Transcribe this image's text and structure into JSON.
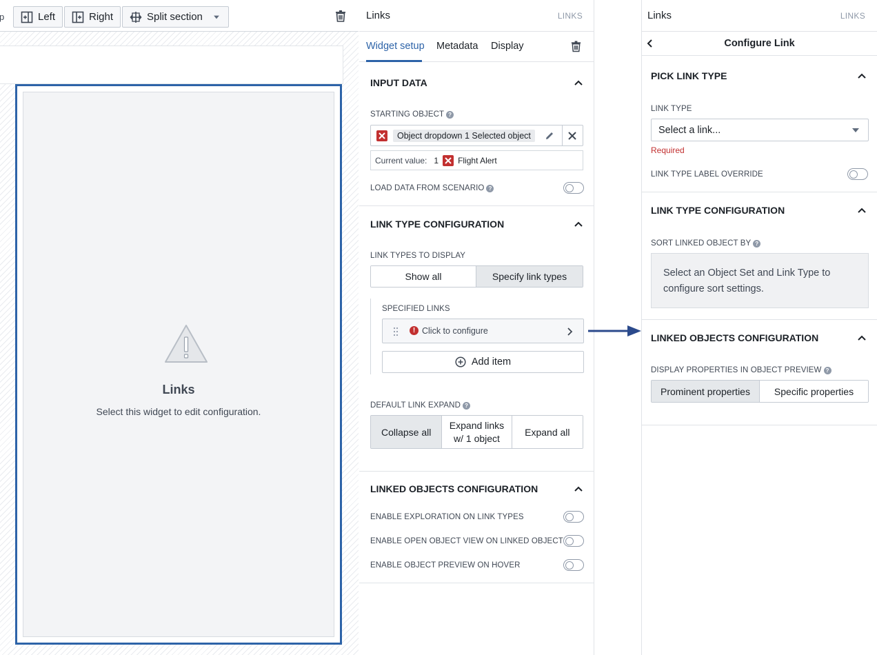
{
  "toolbar": {
    "cut_label": "p",
    "left_label": "Left",
    "right_label": "Right",
    "split_label": "Split section"
  },
  "widget": {
    "title": "Links",
    "subtitle": "Select this widget to edit configuration."
  },
  "panel1": {
    "title": "Links",
    "tag": "LINKS",
    "tabs": [
      "Widget setup",
      "Metadata",
      "Display"
    ],
    "active_tab": "Widget setup",
    "input_data": {
      "title": "INPUT DATA",
      "starting_object_label": "STARTING OBJECT",
      "starting_object_value": "Object dropdown 1 Selected object",
      "current_value_label": "Current value:",
      "current_value_count": "1",
      "current_value_name": "Flight Alert",
      "load_scenario_label": "LOAD DATA FROM SCENARIO"
    },
    "link_type_config": {
      "title": "LINK TYPE CONFIGURATION",
      "display_label": "LINK TYPES TO DISPLAY",
      "options": [
        "Show all",
        "Specify link types"
      ],
      "selected": "Specify link types",
      "specified_links_label": "SPECIFIED LINKS",
      "configure_text": "Click to configure",
      "add_item_label": "Add item",
      "default_expand_label": "DEFAULT LINK EXPAND",
      "expand_options": [
        "Collapse all",
        "Expand links w/ 1 object",
        "Expand all"
      ],
      "expand_selected": "Collapse all"
    },
    "linked_objects": {
      "title": "LINKED OBJECTS CONFIGURATION",
      "toggles": [
        "ENABLE EXPLORATION ON LINK TYPES",
        "ENABLE OPEN OBJECT VIEW ON LINKED OBJECTS",
        "ENABLE OBJECT PREVIEW ON HOVER"
      ]
    }
  },
  "panel2": {
    "title": "Links",
    "tag": "LINKS",
    "subheader": "Configure Link",
    "pick": {
      "title": "PICK LINK TYPE",
      "link_type_label": "LINK TYPE",
      "select_placeholder": "Select a link...",
      "required_text": "Required",
      "override_label": "LINK TYPE LABEL OVERRIDE"
    },
    "ltc": {
      "title": "LINK TYPE CONFIGURATION",
      "sort_label": "SORT LINKED OBJECT BY",
      "info_text": "Select an Object Set and Link Type to configure sort settings."
    },
    "loc": {
      "title": "LINKED OBJECTS CONFIGURATION",
      "display_label": "DISPLAY PROPERTIES IN OBJECT PREVIEW",
      "options": [
        "Prominent properties",
        "Specific properties"
      ],
      "selected": "Prominent properties"
    }
  },
  "colors": {
    "accent": "#2d63a8",
    "danger": "#c23030",
    "arrow": "#2b4a8c"
  }
}
